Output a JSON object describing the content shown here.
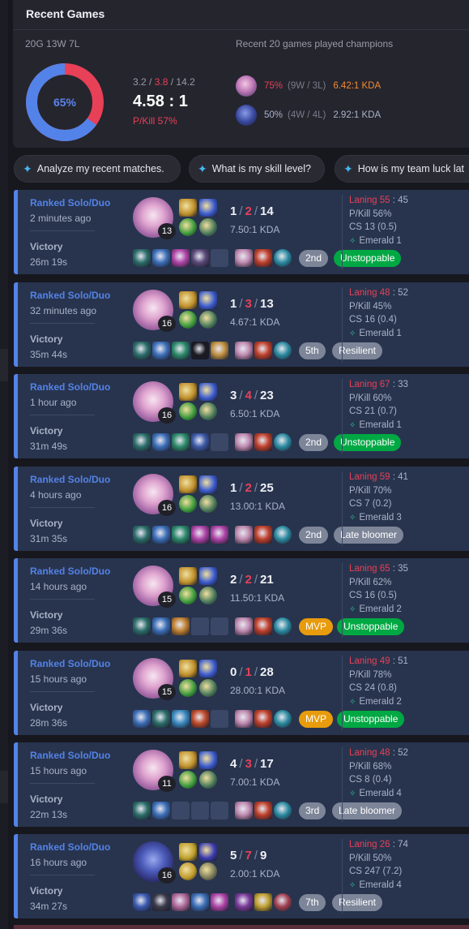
{
  "header": {
    "title": "Recent Games"
  },
  "summary": {
    "record": "20G 13W 7L",
    "winrate": "65%",
    "winrate_value": 0.65,
    "kills": "3.2",
    "deaths": "3.8",
    "assists": "14.2",
    "kda_ratio": "4.58 : 1",
    "pkill": "P/Kill 57%",
    "colors": {
      "win": "#5383e8",
      "loss": "#e84057"
    }
  },
  "recent_champions": {
    "title": "Recent 20 games played champions",
    "items": [
      {
        "winrate": "75%",
        "wl": "(9W / 3L)",
        "kda": "6.42:1 KDA",
        "winrate_color": "#e84057",
        "kda_color": "#f28b30",
        "icon": "champion-portrait-pink"
      },
      {
        "winrate": "50%",
        "wl": "(4W / 4L)",
        "kda": "2.92:1 KDA",
        "winrate_color": "#a8b3c8",
        "kda_color": "#a8b3c8",
        "icon": "champion-portrait-blue"
      }
    ]
  },
  "ai_chips": [
    {
      "label": "Analyze my recent matches."
    },
    {
      "label": "What is my skill level?"
    },
    {
      "label": "How is my team luck lat"
    }
  ],
  "games": [
    {
      "queue": "Ranked Solo/Duo",
      "ago": "2 minutes ago",
      "result": "Victory",
      "duration": "26m 19s",
      "level": "13",
      "k": "1",
      "d": "2",
      "a": "14",
      "ratio": "7.50:1 KDA",
      "laning_label": "Laning",
      "laning_a": "55",
      "laning_b": "45",
      "pkill": "P/Kill 56%",
      "cs": "CS 13 (0.5)",
      "rank": "Emerald 1",
      "place": "2nd",
      "place_type": "place",
      "tag": "Unstoppable",
      "tag_type": "unst",
      "items": [
        "#2c6e6a",
        "#3c6fb8",
        "#b044a8",
        "#5a4a78",
        "",
        "#c08ab0",
        "#c0402a",
        "#2a8aa0"
      ],
      "champ": "pink"
    },
    {
      "queue": "Ranked Solo/Duo",
      "ago": "32 minutes ago",
      "result": "Victory",
      "duration": "35m 44s",
      "level": "16",
      "k": "1",
      "d": "3",
      "a": "13",
      "ratio": "4.67:1 KDA",
      "laning_label": "Laning",
      "laning_a": "48",
      "laning_b": "52",
      "pkill": "P/Kill 45%",
      "cs": "CS 16 (0.4)",
      "rank": "Emerald 1",
      "place": "5th",
      "place_type": "place",
      "tag": "Resilient",
      "tag_type": "gray",
      "items": [
        "#2c6e6a",
        "#3c6fb8",
        "#2c8a6a",
        "#1a1a22",
        "#c09040",
        "#c08ab0",
        "#c0402a",
        "#2a8aa0"
      ],
      "champ": "pink"
    },
    {
      "queue": "Ranked Solo/Duo",
      "ago": "1 hour ago",
      "result": "Victory",
      "duration": "31m 49s",
      "level": "16",
      "k": "3",
      "d": "4",
      "a": "23",
      "ratio": "6.50:1 KDA",
      "laning_label": "Laning",
      "laning_a": "67",
      "laning_b": "33",
      "pkill": "P/Kill 60%",
      "cs": "CS 21 (0.7)",
      "rank": "Emerald 1",
      "place": "2nd",
      "place_type": "place",
      "tag": "Unstoppable",
      "tag_type": "unst",
      "items": [
        "#2c6e6a",
        "#3c6fb8",
        "#2c8a6a",
        "#3c5aa8",
        "",
        "#c08ab0",
        "#c0402a",
        "#2a8aa0"
      ],
      "champ": "pink"
    },
    {
      "queue": "Ranked Solo/Duo",
      "ago": "4 hours ago",
      "result": "Victory",
      "duration": "31m 35s",
      "level": "16",
      "k": "1",
      "d": "2",
      "a": "25",
      "ratio": "13.00:1 KDA",
      "laning_label": "Laning",
      "laning_a": "59",
      "laning_b": "41",
      "pkill": "P/Kill 70%",
      "cs": "CS 7 (0.2)",
      "rank": "Emerald 3",
      "place": "2nd",
      "place_type": "place",
      "tag": "Late bloomer",
      "tag_type": "gray",
      "items": [
        "#2c6e6a",
        "#3c6fb8",
        "#2c8a6a",
        "#b044a8",
        "#b044a8",
        "#c08ab0",
        "#c0402a",
        "#2a8aa0"
      ],
      "champ": "pink"
    },
    {
      "queue": "Ranked Solo/Duo",
      "ago": "14 hours ago",
      "result": "Victory",
      "duration": "29m 36s",
      "level": "15",
      "k": "2",
      "d": "2",
      "a": "21",
      "ratio": "11.50:1 KDA",
      "laning_label": "Laning",
      "laning_a": "65",
      "laning_b": "35",
      "pkill": "P/Kill 62%",
      "cs": "CS 16 (0.5)",
      "rank": "Emerald 2",
      "place": "MVP",
      "place_type": "mvp",
      "tag": "Unstoppable",
      "tag_type": "unst",
      "items": [
        "#2c6e6a",
        "#3c6fb8",
        "#c08030",
        "",
        "",
        "#c08ab0",
        "#c0402a",
        "#2a8aa0"
      ],
      "champ": "pink"
    },
    {
      "queue": "Ranked Solo/Duo",
      "ago": "15 hours ago",
      "result": "Victory",
      "duration": "28m 36s",
      "level": "15",
      "k": "0",
      "d": "1",
      "a": "28",
      "ratio": "28.00:1 KDA",
      "laning_label": "Laning",
      "laning_a": "49",
      "laning_b": "51",
      "pkill": "P/Kill 78%",
      "cs": "CS 24 (0.8)",
      "rank": "Emerald 2",
      "place": "MVP",
      "place_type": "mvp",
      "tag": "Unstoppable",
      "tag_type": "unst",
      "items": [
        "#3c6fb8",
        "#2c6e6a",
        "#3a8ac0",
        "#c04a2a",
        "",
        "#c08ab0",
        "#c0402a",
        "#2a8aa0"
      ],
      "champ": "pink"
    },
    {
      "queue": "Ranked Solo/Duo",
      "ago": "15 hours ago",
      "result": "Victory",
      "duration": "22m 13s",
      "level": "11",
      "k": "4",
      "d": "3",
      "a": "17",
      "ratio": "7.00:1 KDA",
      "laning_label": "Laning",
      "laning_a": "48",
      "laning_b": "52",
      "pkill": "P/Kill 68%",
      "cs": "CS 8 (0.4)",
      "rank": "Emerald 4",
      "place": "3rd",
      "place_type": "place",
      "tag": "Late bloomer",
      "tag_type": "gray",
      "items": [
        "#2c6e6a",
        "#3c6fb8",
        "",
        "",
        "",
        "#c08ab0",
        "#c0402a",
        "#2a8aa0"
      ],
      "champ": "pink"
    },
    {
      "queue": "Ranked Solo/Duo",
      "ago": "16 hours ago",
      "result": "Victory",
      "duration": "34m 27s",
      "level": "16",
      "k": "5",
      "d": "7",
      "a": "9",
      "ratio": "2.00:1 KDA",
      "laning_label": "Laning",
      "laning_a": "26",
      "laning_b": "74",
      "pkill": "P/Kill 50%",
      "cs": "CS 247 (7.2)",
      "rank": "Emerald 4",
      "place": "7th",
      "place_type": "place",
      "tag": "Resilient",
      "tag_type": "gray",
      "items": [
        "#3a5ab0",
        "#3a3a4a",
        "#b06a9a",
        "#3c6fb8",
        "#b044a8",
        "#7a3a9a",
        "#c0a030",
        "#a04050"
      ],
      "champ": "blue"
    }
  ]
}
